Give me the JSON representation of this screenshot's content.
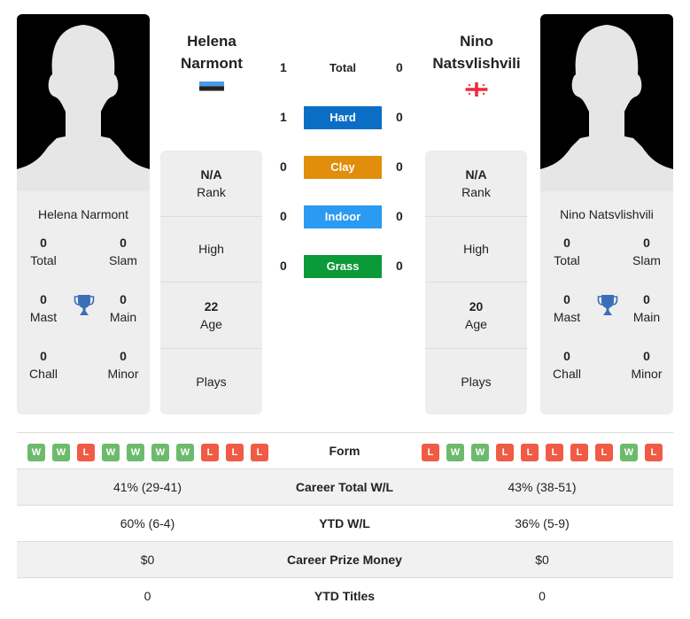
{
  "colors": {
    "hard": "#0a6ec5",
    "clay": "#e08e0b",
    "indoor": "#2a9af2",
    "grass": "#0a9a3a",
    "win": "#6cbb6c",
    "loss": "#ef5b45",
    "trophy": "#3a6fb8"
  },
  "player1": {
    "name_line1": "Helena",
    "name_line2": "Narmont",
    "full_name": "Helena Narmont",
    "flag": "estonia-flag",
    "titles": {
      "total": {
        "value": "0",
        "label": "Total"
      },
      "slam": {
        "value": "0",
        "label": "Slam"
      },
      "mast": {
        "value": "0",
        "label": "Mast"
      },
      "main": {
        "value": "0",
        "label": "Main"
      },
      "chall": {
        "value": "0",
        "label": "Chall"
      },
      "minor": {
        "value": "0",
        "label": "Minor"
      }
    },
    "info": {
      "rank_value": "N/A",
      "rank_label": "Rank",
      "high_label": "High",
      "age_value": "22",
      "age_label": "Age",
      "plays_label": "Plays"
    },
    "form": [
      "W",
      "W",
      "L",
      "W",
      "W",
      "W",
      "W",
      "L",
      "L",
      "L"
    ],
    "career_wl": "41% (29-41)",
    "ytd_wl": "60% (6-4)",
    "prize_money": "$0",
    "ytd_titles": "0"
  },
  "player2": {
    "name_line1": "Nino",
    "name_line2": "Natsvlishvili",
    "full_name": "Nino Natsvlishvili",
    "flag": "georgia-flag",
    "titles": {
      "total": {
        "value": "0",
        "label": "Total"
      },
      "slam": {
        "value": "0",
        "label": "Slam"
      },
      "mast": {
        "value": "0",
        "label": "Mast"
      },
      "main": {
        "value": "0",
        "label": "Main"
      },
      "chall": {
        "value": "0",
        "label": "Chall"
      },
      "minor": {
        "value": "0",
        "label": "Minor"
      }
    },
    "info": {
      "rank_value": "N/A",
      "rank_label": "Rank",
      "high_label": "High",
      "age_value": "20",
      "age_label": "Age",
      "plays_label": "Plays"
    },
    "form": [
      "L",
      "W",
      "W",
      "L",
      "L",
      "L",
      "L",
      "L",
      "W",
      "L"
    ],
    "career_wl": "43% (38-51)",
    "ytd_wl": "36% (5-9)",
    "prize_money": "$0",
    "ytd_titles": "0"
  },
  "h2h": [
    {
      "label": "Total",
      "p1": "1",
      "p2": "0"
    },
    {
      "label": "Hard",
      "p1": "1",
      "p2": "0"
    },
    {
      "label": "Clay",
      "p1": "0",
      "p2": "0"
    },
    {
      "label": "Indoor",
      "p1": "0",
      "p2": "0"
    },
    {
      "label": "Grass",
      "p1": "0",
      "p2": "0"
    }
  ],
  "stats_labels": {
    "form": "Form",
    "career_wl": "Career Total W/L",
    "ytd_wl": "YTD W/L",
    "prize_money": "Career Prize Money",
    "ytd_titles": "YTD Titles"
  }
}
